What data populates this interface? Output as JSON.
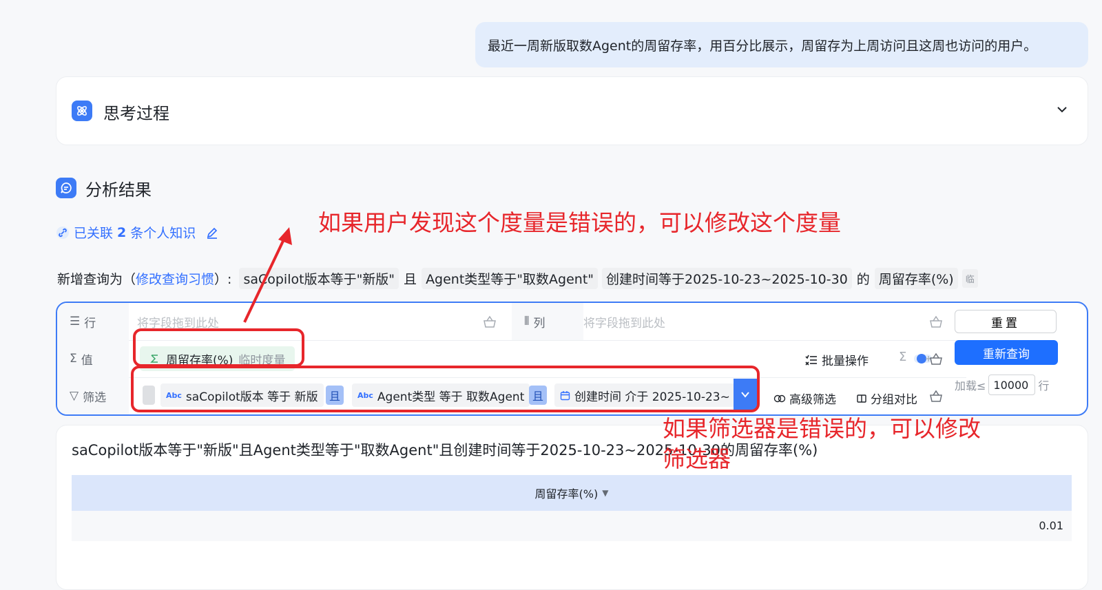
{
  "chat": {
    "user_message": "最近一周新版取数Agent的周留存率，用百分比展示，周留存为上周访问且这周也访问的用户。"
  },
  "thinking": {
    "title": "思考过程"
  },
  "result": {
    "title": "分析结果",
    "knowledge_prefix": "已关联",
    "knowledge_count": "2",
    "knowledge_suffix": "条个人知识"
  },
  "query": {
    "prefix": "新增查询为（",
    "habit_link": "修改查询习惯",
    "after_link": "）:",
    "cond1": "saCopilot版本等于\"新版\"",
    "and1": "且",
    "cond2": "Agent类型等于\"取数Agent\"",
    "cond3": "创建时间等于2025-10-23~2025-10-30",
    "of": "的",
    "metric": "周留存率(%)",
    "temp_tag": "临"
  },
  "panel": {
    "rows_label": "行",
    "cols_label": "列",
    "values_label": "值",
    "filter_label": "筛选",
    "drop_placeholder": "将字段拖到此处",
    "measure_name": "周留存率(%)",
    "measure_tag": "临时度量",
    "batch_label": "批量操作",
    "filter1": "saCopilot版本 等于 新版",
    "filter_and": "且",
    "filter2": "Agent类型 等于 取数Agent",
    "filter3": "创建时间 介于 2025-10-23~",
    "advanced_filter": "高级筛选",
    "group_compare": "分组对比",
    "reset_label": "重置",
    "requery_label": "重新查询",
    "load_label": "加载≤",
    "load_value": "10000",
    "load_unit": "行"
  },
  "table": {
    "title": "saCopilot版本等于\"新版\"且Agent类型等于\"取数Agent\"且创建时间等于2025-10-23~2025-10-30的周留存率(%)",
    "header": "周留存率(%)",
    "value": "0.01"
  },
  "annotations": {
    "measure_note": "如果用户发现这个度量是错误的，可以修改这个度量",
    "filter_note_line1": "如果筛选器是错误的，可以修改",
    "filter_note_line2": "筛选器"
  },
  "colors": {
    "accent": "#3d7bf6",
    "annotation_red": "#e7262b",
    "measure_chip_bg": "#e8f6ee"
  }
}
